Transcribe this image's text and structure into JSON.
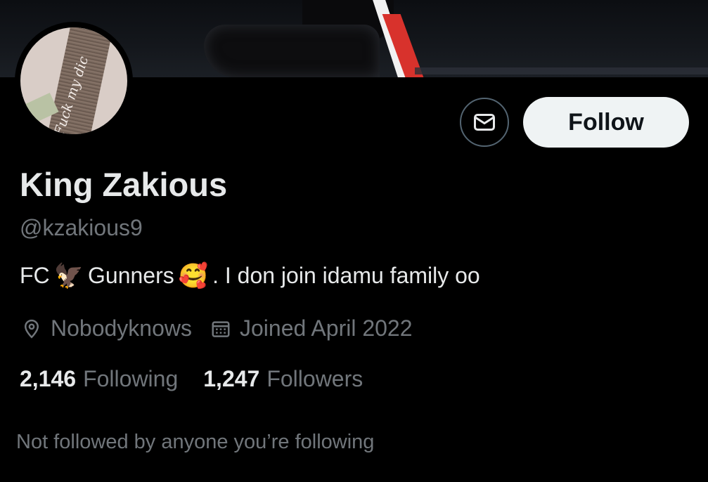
{
  "profile": {
    "display_name": "King Zakious",
    "handle": "@kzakious9",
    "avatar_text": "Fuck my dic",
    "bio": {
      "part1": "FC",
      "emoji1": "🦅",
      "part2": "Gunners",
      "emoji2": "🥰",
      "part3": ". I don join idamu family oo"
    },
    "location": "Nobodyknows",
    "joined": "Joined April 2022",
    "following_count": "2,146",
    "following_label": "Following",
    "followers_count": "1,247",
    "followers_label": "Followers",
    "followed_by_note": "Not followed by anyone you’re following"
  },
  "actions": {
    "follow_label": "Follow",
    "message_icon": "envelope-icon"
  },
  "icons": {
    "location": "location-pin-icon",
    "joined": "calendar-icon"
  },
  "colors": {
    "background": "#000000",
    "primary_text": "#e7e9ea",
    "secondary_text": "#71767b",
    "follow_button_bg": "#eff3f4",
    "follow_button_text": "#0f1419",
    "button_border": "#536471"
  }
}
